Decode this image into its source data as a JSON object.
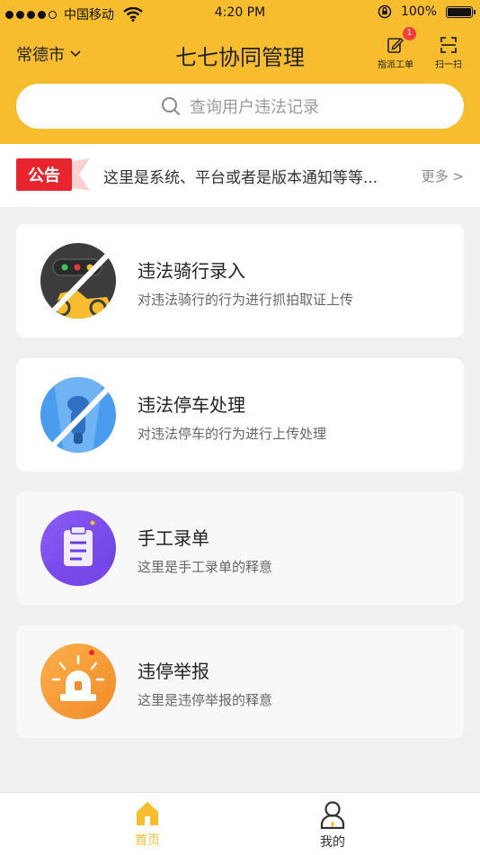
{
  "status_bar": {
    "carrier": "中国移动",
    "time": "4:20 PM",
    "battery": "100%"
  },
  "header": {
    "city": "常德市",
    "title": "七七协同管理",
    "dispatch_label": "指派工单",
    "dispatch_badge": "1",
    "scan_label": "扫一扫",
    "accent_color": "#f7bd2e"
  },
  "search": {
    "placeholder": "查询用户违法记录"
  },
  "notice": {
    "tag": "公告",
    "text": "这里是系统、平台或者是版本通知等等...",
    "more": "更多 >"
  },
  "cards": [
    {
      "title": "违法骑行录入",
      "subtitle": "对违法骑行的行为进行抓拍取证上传",
      "icon": "illegal-riding-icon"
    },
    {
      "title": "违法停车处理",
      "subtitle": "对违法停车的行为进行上传处理",
      "icon": "illegal-parking-icon"
    },
    {
      "title": "手工录单",
      "subtitle": "这里是手工录单的释意",
      "icon": "clipboard-icon"
    },
    {
      "title": "违停举报",
      "subtitle": "这里是违停举报的释意",
      "icon": "alarm-light-icon"
    }
  ],
  "tabbar": {
    "items": [
      {
        "label": "首页",
        "icon": "home-icon",
        "active": true
      },
      {
        "label": "我的",
        "icon": "user-icon",
        "active": false
      }
    ],
    "active_color": "#f7bd2e"
  }
}
